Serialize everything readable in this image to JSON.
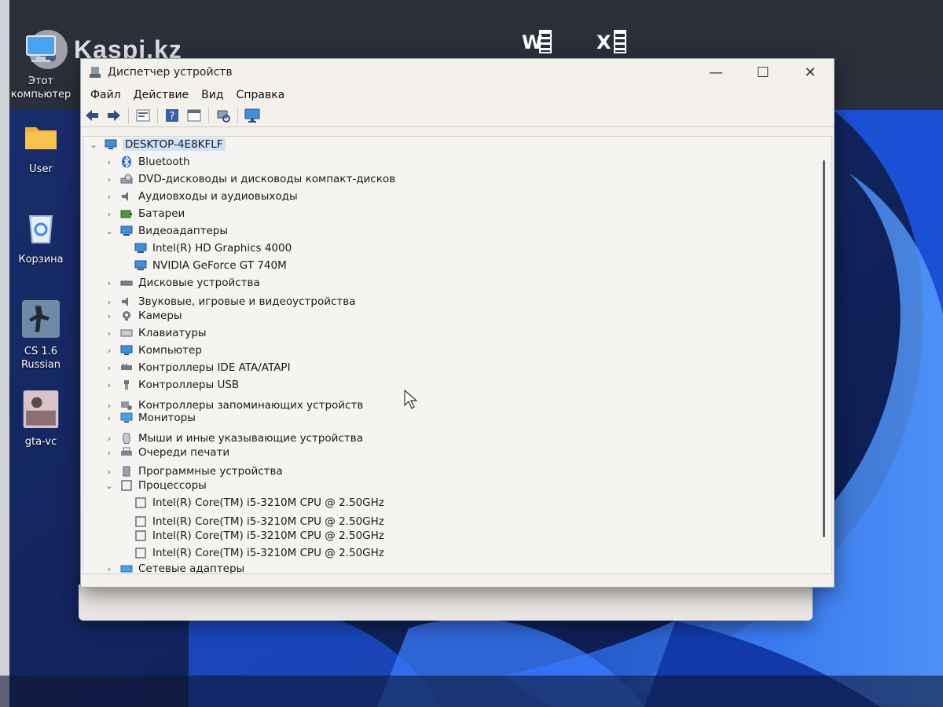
{
  "watermark": {
    "text": "Kaspi.kz"
  },
  "desktop": {
    "icons": [
      {
        "label_line1": "Этот",
        "label_line2": "компьютер",
        "icon": "computer-icon"
      },
      {
        "label_line1": "User",
        "icon": "folder-icon"
      },
      {
        "label_line1": "Корзина",
        "icon": "recycle-bin-icon"
      },
      {
        "label_line1": "CS 1.6",
        "label_line2": "Russian",
        "icon": "counter-strike-icon"
      },
      {
        "label_line1": "gta-vc",
        "icon": "gta-vc-icon"
      }
    ],
    "office": {
      "word_letter": "W",
      "excel_letter": "X"
    }
  },
  "window": {
    "title": "Диспетчер устройств",
    "controls": {
      "minimize": "—",
      "maximize": "☐",
      "close": "✕"
    },
    "menu": [
      "Файл",
      "Действие",
      "Вид",
      "Справка"
    ],
    "toolbar_icons": [
      "back-arrow-icon",
      "forward-arrow-icon",
      "properties-icon",
      "help-icon",
      "view-icon",
      "scan-hardware-icon",
      "monitor-icon"
    ]
  },
  "tree": {
    "root": "DESKTOP-4E8KFLF",
    "nodes": [
      {
        "label": "Bluetooth",
        "level": 1,
        "expanded": false,
        "icon": "bluetooth-icon"
      },
      {
        "label": "DVD-дисководы и дисководы компакт-дисков",
        "level": 1,
        "expanded": false,
        "icon": "dvd-drive-icon"
      },
      {
        "label": "Аудиовходы и аудиовыходы",
        "level": 1,
        "expanded": false,
        "icon": "speaker-icon"
      },
      {
        "label": "Батареи",
        "level": 1,
        "expanded": false,
        "icon": "battery-icon"
      },
      {
        "label": "Видеоадаптеры",
        "level": 1,
        "expanded": true,
        "icon": "display-adapter-icon"
      },
      {
        "label": "Intel(R) HD Graphics 4000",
        "level": 2,
        "icon": "display-adapter-icon"
      },
      {
        "label": "NVIDIA GeForce GT 740M",
        "level": 2,
        "icon": "display-adapter-icon"
      },
      {
        "label": "Дисковые устройства",
        "level": 1,
        "expanded": false,
        "icon": "disk-drive-icon"
      },
      {
        "label": "Звуковые, игровые и видеоустройства",
        "level": 1,
        "expanded": false,
        "icon": "speaker-icon"
      },
      {
        "label": "Камеры",
        "level": 1,
        "expanded": false,
        "icon": "camera-icon"
      },
      {
        "label": "Клавиатуры",
        "level": 1,
        "expanded": false,
        "icon": "keyboard-icon"
      },
      {
        "label": "Компьютер",
        "level": 1,
        "expanded": false,
        "icon": "computer-icon"
      },
      {
        "label": "Контроллеры IDE ATA/ATAPI",
        "level": 1,
        "expanded": false,
        "icon": "ide-controller-icon"
      },
      {
        "label": "Контроллеры USB",
        "level": 1,
        "expanded": false,
        "icon": "usb-icon"
      },
      {
        "label": "Контроллеры запоминающих устройств",
        "level": 1,
        "expanded": false,
        "icon": "storage-controller-icon"
      },
      {
        "label": "Мониторы",
        "level": 1,
        "expanded": false,
        "icon": "monitor-icon"
      },
      {
        "label": "Мыши и иные указывающие устройства",
        "level": 1,
        "expanded": false,
        "icon": "mouse-icon"
      },
      {
        "label": "Очереди печати",
        "level": 1,
        "expanded": false,
        "icon": "printer-icon"
      },
      {
        "label": "Программные устройства",
        "level": 1,
        "expanded": false,
        "icon": "software-device-icon"
      },
      {
        "label": "Процессоры",
        "level": 1,
        "expanded": true,
        "icon": "processor-icon"
      },
      {
        "label": "Intel(R) Core(TM) i5-3210M CPU @ 2.50GHz",
        "level": 2,
        "icon": "processor-icon"
      },
      {
        "label": "Intel(R) Core(TM) i5-3210M CPU @ 2.50GHz",
        "level": 2,
        "icon": "processor-icon"
      },
      {
        "label": "Intel(R) Core(TM) i5-3210M CPU @ 2.50GHz",
        "level": 2,
        "icon": "processor-icon"
      },
      {
        "label": "Intel(R) Core(TM) i5-3210M CPU @ 2.50GHz",
        "level": 2,
        "icon": "processor-icon"
      },
      {
        "label": "Сетевые адаптеры",
        "level": 1,
        "expanded": false,
        "icon": "network-adapter-icon"
      }
    ]
  },
  "colors": {
    "selection": "#cfe2f5",
    "window_bg": "#f4f1ed",
    "desktop_bg": "#0b1f56"
  }
}
